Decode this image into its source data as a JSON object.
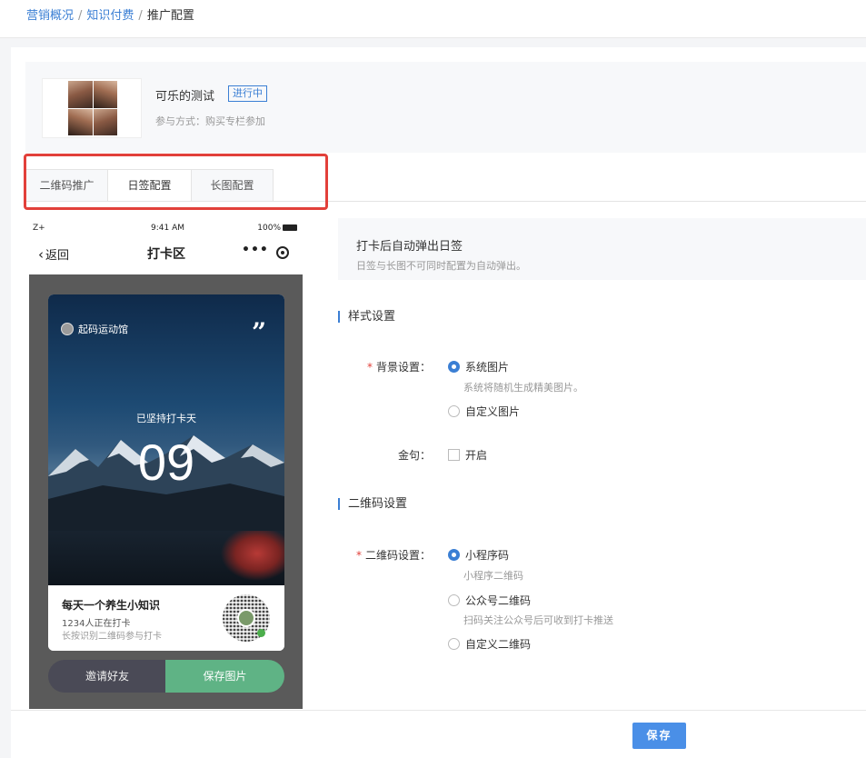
{
  "breadcrumb": {
    "item1": "营销概况",
    "item2": "知识付费",
    "sep": "/",
    "current": "推广配置"
  },
  "summary": {
    "title": "可乐的测试",
    "badge": "进行中",
    "participation": "参与方式：购买专栏参加"
  },
  "tabs": [
    {
      "label": "二维码推广"
    },
    {
      "label": "日签配置"
    },
    {
      "label": "长图配置"
    }
  ],
  "phone": {
    "signal": "Z+",
    "time": "9:41 AM",
    "battery": "100%",
    "back": "返回",
    "title": "打卡区",
    "more": "•••",
    "brand": "起码运动馆",
    "quote": "”",
    "kept_label": "已坚持打卡天",
    "days": "09",
    "foot_title": "每天一个养生小知识",
    "foot_count": "1234人正在打卡",
    "foot_hint": "长按识别二维码参与打卡",
    "invite": "邀请好友",
    "save_image": "保存图片"
  },
  "auto": {
    "title": "打卡后自动弹出日签",
    "subtitle": "日签与长图不可同时配置为自动弹出。"
  },
  "style": {
    "section": "样式设置",
    "bg_label": "背景设置：",
    "bg_options": [
      {
        "label": "系统图片",
        "hint": "系统将随机生成精美图片。",
        "selected": true
      },
      {
        "label": "自定义图片",
        "selected": false
      }
    ],
    "quote_label": "金句：",
    "quote_option": "开启"
  },
  "qrcode": {
    "section": "二维码设置",
    "label": "二维码设置：",
    "options": [
      {
        "label": "小程序码",
        "hint": "小程序二维码",
        "selected": true
      },
      {
        "label": "公众号二维码",
        "hint": "扫码关注公众号后可收到打卡推送",
        "selected": false
      },
      {
        "label": "自定义二维码",
        "selected": false
      }
    ]
  },
  "footer": {
    "save": "保存"
  },
  "colors": {
    "accent": "#3b7fd4",
    "highlight": "#e2403a",
    "save_green": "#5fb385"
  }
}
